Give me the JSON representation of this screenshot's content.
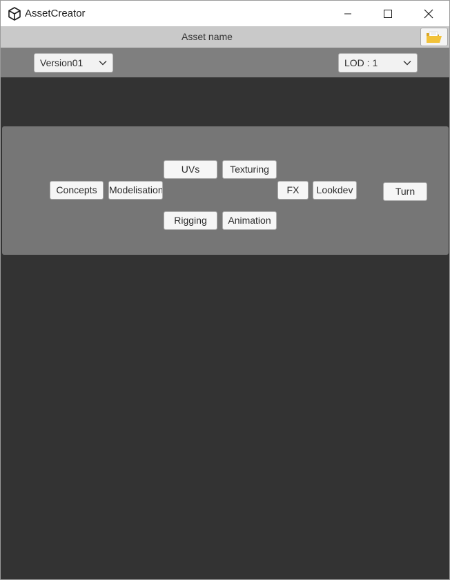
{
  "window": {
    "title": "AssetCreator",
    "app_icon": "unity-logo-icon",
    "controls": {
      "minimize_icon": "minimize-icon",
      "maximize_icon": "maximize-icon",
      "close_icon": "close-icon"
    }
  },
  "header": {
    "asset_name": "Asset name",
    "folder_icon": "open-folder-icon"
  },
  "toolbar": {
    "version": {
      "selected": "Version01",
      "icon": "chevron-down-icon"
    },
    "lod": {
      "selected": "LOD : 1",
      "icon": "chevron-down-icon"
    }
  },
  "pipeline": {
    "steps": {
      "concepts": "Concepts",
      "modelisation": "Modelisation",
      "uvs": "UVs",
      "texturing": "Texturing",
      "rigging": "Rigging",
      "animation": "Animation",
      "fx": "FX",
      "lookdev": "Lookdev",
      "turn": "Turn"
    }
  },
  "colors": {
    "background": "#333333",
    "name_bar": "#c9c9c9",
    "dropdown_bar": "#7f7f7f",
    "panel": "#767676",
    "folder_icon": "#f2c23a"
  }
}
